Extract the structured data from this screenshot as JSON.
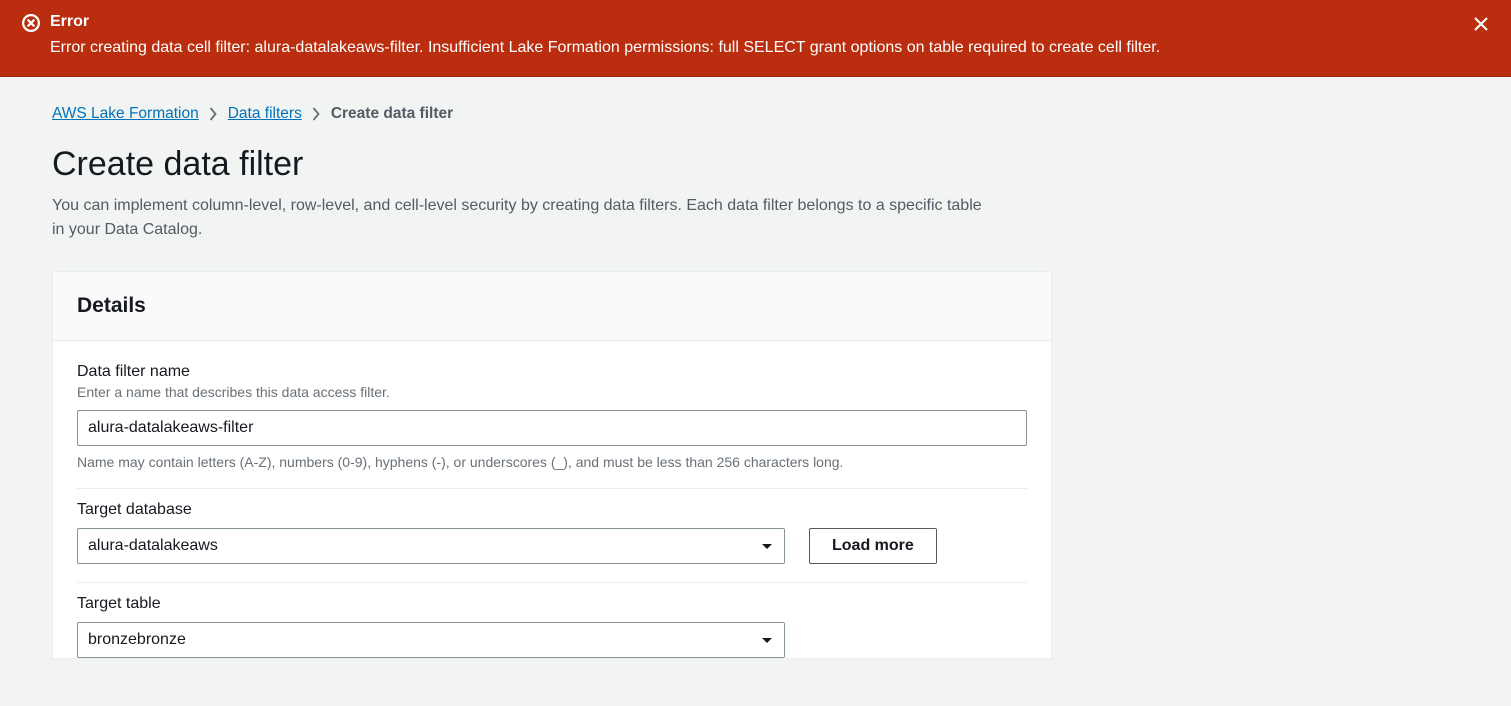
{
  "error": {
    "title": "Error",
    "message": "Error creating data cell filter: alura-datalakeaws-filter. Insufficient Lake Formation permissions: full SELECT grant options on table required to create cell filter."
  },
  "breadcrumb": {
    "items": [
      {
        "label": "AWS Lake Formation"
      },
      {
        "label": "Data filters"
      }
    ],
    "current": "Create data filter"
  },
  "page": {
    "title": "Create data filter",
    "description": "You can implement column-level, row-level, and cell-level security by creating data filters. Each data filter belongs to a specific table in your Data Catalog."
  },
  "panel": {
    "header": "Details",
    "fields": {
      "name": {
        "label": "Data filter name",
        "hint": "Enter a name that describes this data access filter.",
        "value": "alura-datalakeaws-filter",
        "help": "Name may contain letters (A-Z), numbers (0-9), hyphens (-), or underscores (_), and must be less than 256 characters long."
      },
      "database": {
        "label": "Target database",
        "value": "alura-datalakeaws",
        "load_more_label": "Load more"
      },
      "table": {
        "label": "Target table",
        "value": "bronzebronze"
      }
    }
  }
}
